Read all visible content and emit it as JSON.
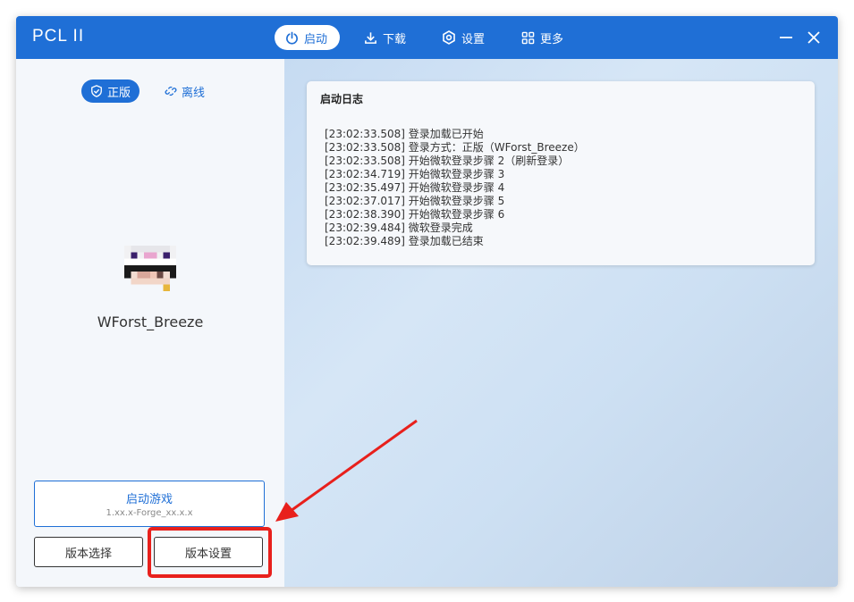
{
  "app": {
    "title": "PCL II"
  },
  "nav": [
    {
      "label": "启动",
      "icon": "power-icon",
      "active": true
    },
    {
      "label": "下载",
      "icon": "download-icon",
      "active": false
    },
    {
      "label": "设置",
      "icon": "gear-icon",
      "active": false
    },
    {
      "label": "更多",
      "icon": "grid-icon",
      "active": false
    }
  ],
  "sidebar": {
    "mode_online": "正版",
    "mode_offline": "离线",
    "username": "WForst_Breeze",
    "launch_label": "启动游戏",
    "launch_version": "1.xx.x-Forge_xx.x.x",
    "version_select": "版本选择",
    "version_settings": "版本设置"
  },
  "log": {
    "title": "启动日志",
    "lines": [
      "[23:02:33.508] 登录加载已开始",
      "[23:02:33.508] 登录方式：正版（WForst_Breeze）",
      "[23:02:33.508] 开始微软登录步骤 2（刷新登录）",
      "[23:02:34.719] 开始微软登录步骤 3",
      "[23:02:35.497] 开始微软登录步骤 4",
      "[23:02:37.017] 开始微软登录步骤 5",
      "[23:02:38.390] 开始微软登录步骤 6",
      "[23:02:39.484] 微软登录完成",
      "[23:02:39.489] 登录加载已结束"
    ]
  },
  "colors": {
    "accent": "#1f6fd6",
    "annotation": "#e8201c"
  }
}
